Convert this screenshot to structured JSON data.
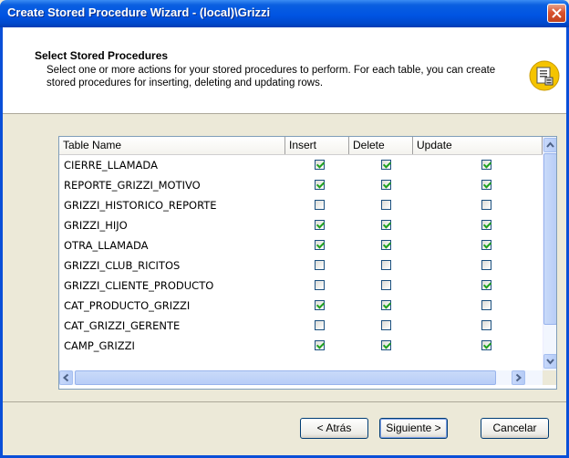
{
  "window": {
    "title": "Create Stored Procedure Wizard - (local)\\Grizzi"
  },
  "header": {
    "title": "Select Stored Procedures",
    "description": "Select one or more actions for your stored procedures to perform. For each table, you can create stored procedures for inserting, deleting and updating rows."
  },
  "grid": {
    "columns": [
      "Table Name",
      "Insert",
      "Delete",
      "Update"
    ],
    "rows": [
      {
        "name": "CIERRE_LLAMADA",
        "insert": true,
        "delete": true,
        "update": true
      },
      {
        "name": "REPORTE_GRIZZI_MOTIVO",
        "insert": true,
        "delete": true,
        "update": true
      },
      {
        "name": "GRIZZI_HISTORICO_REPORTE",
        "insert": false,
        "delete": false,
        "update": false
      },
      {
        "name": "GRIZZI_HIJO",
        "insert": true,
        "delete": true,
        "update": true
      },
      {
        "name": "OTRA_LLAMADA",
        "insert": true,
        "delete": true,
        "update": true
      },
      {
        "name": "GRIZZI_CLUB_RICITOS",
        "insert": false,
        "delete": false,
        "update": false
      },
      {
        "name": "GRIZZI_CLIENTE_PRODUCTO",
        "insert": false,
        "delete": false,
        "update": true
      },
      {
        "name": "CAT_PRODUCTO_GRIZZI",
        "insert": true,
        "delete": true,
        "update": false
      },
      {
        "name": "CAT_GRIZZI_GERENTE",
        "insert": false,
        "delete": false,
        "update": false
      },
      {
        "name": "CAMP_GRIZZI",
        "insert": true,
        "delete": true,
        "update": true
      }
    ]
  },
  "buttons": {
    "back": "< Atrás",
    "next": "Siguiente >",
    "cancel": "Cancelar"
  },
  "colors": {
    "titlebar": "#0054e3",
    "check": "#21a121",
    "close": "#d9522e"
  }
}
